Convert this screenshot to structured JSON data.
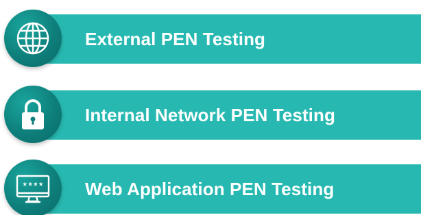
{
  "items": [
    {
      "label": "External PEN Testing",
      "icon": "globe-icon"
    },
    {
      "label": "Internal Network PEN Testing",
      "icon": "padlock-icon"
    },
    {
      "label": "Web Application PEN Testing",
      "icon": "monitor-password-icon",
      "icon_text": "****"
    }
  ],
  "colors": {
    "bar": "#27b9b1",
    "badge": "#0e7f7b",
    "text": "#ffffff"
  }
}
